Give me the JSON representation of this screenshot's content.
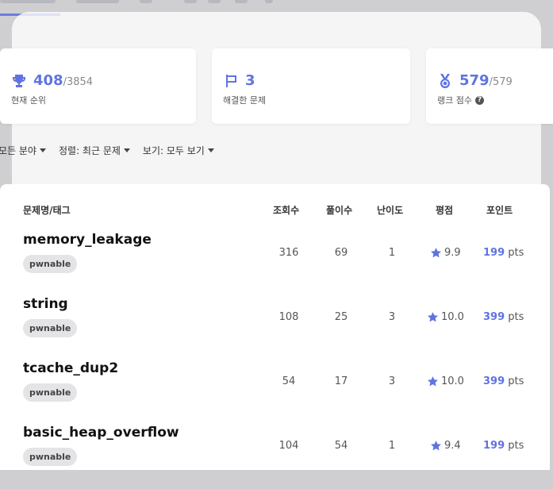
{
  "colors": {
    "accent": "#5f74e2",
    "tag_bg": "#e4e4e6"
  },
  "stats": [
    {
      "icon": "trophy-icon",
      "value": "408",
      "total": "/3854",
      "label": "현재 순위"
    },
    {
      "icon": "flag-icon",
      "value": "3",
      "total": "",
      "label": "해결한 문제"
    },
    {
      "icon": "medal-icon",
      "value": "579",
      "total": "/579",
      "label": "랭크 점수"
    }
  ],
  "filters": {
    "category": "모든 분야",
    "sort": "정렬: 최근 문제",
    "view": "보기: 모두 보기"
  },
  "table": {
    "headers": {
      "name": "문제명/태그",
      "views": "조회수",
      "solves": "풀이수",
      "difficulty": "난이도",
      "rating": "평점",
      "points": "포인트"
    },
    "rows": [
      {
        "title": "memory_leakage",
        "tag": "pwnable",
        "views": "316",
        "solves": "69",
        "difficulty": "1",
        "rating": "9.9",
        "points": "199",
        "unit": "pts"
      },
      {
        "title": "string",
        "tag": "pwnable",
        "views": "108",
        "solves": "25",
        "difficulty": "3",
        "rating": "10.0",
        "points": "399",
        "unit": "pts"
      },
      {
        "title": "tcache_dup2",
        "tag": "pwnable",
        "views": "54",
        "solves": "17",
        "difficulty": "3",
        "rating": "10.0",
        "points": "399",
        "unit": "pts"
      },
      {
        "title": "basic_heap_overflow",
        "tag": "pwnable",
        "views": "104",
        "solves": "54",
        "difficulty": "1",
        "rating": "9.4",
        "points": "199",
        "unit": "pts"
      }
    ]
  }
}
